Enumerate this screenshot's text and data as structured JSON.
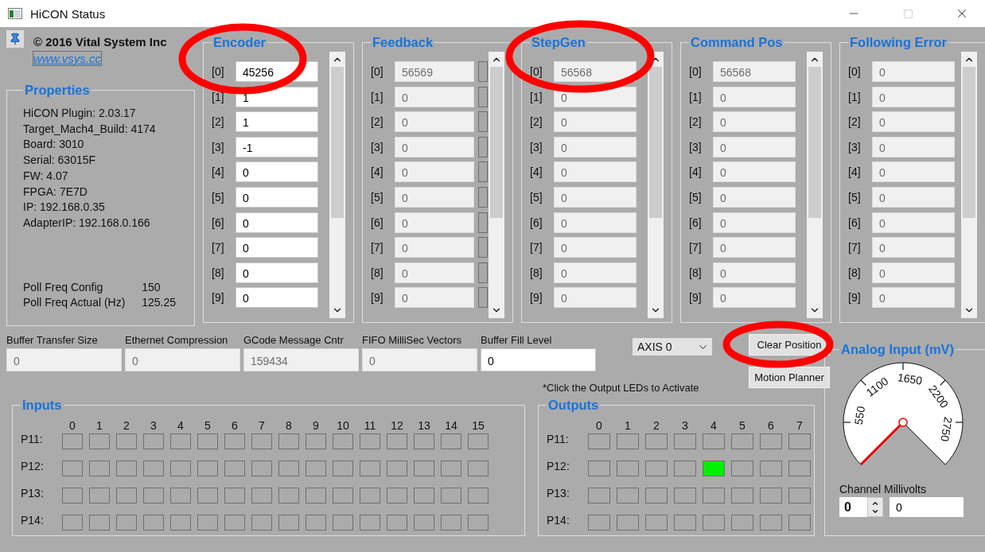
{
  "window": {
    "title": "HiCON Status"
  },
  "about": {
    "copyright": "© 2016 Vital System Inc",
    "link": "www.vsys.cc"
  },
  "properties": {
    "title": "Properties",
    "lines": [
      "HiCON Plugin: 2.03.17",
      "Target_Mach4_Build: 4174",
      "Board: 3010",
      "Serial: 63015F",
      "FW: 4.07",
      "FPGA: 7E7D",
      "IP: 192.168.0.35",
      "AdapterIP: 192.168.0.166"
    ],
    "poll": [
      {
        "label": "Poll Freq Config",
        "value": "150"
      },
      {
        "label": "Poll Freq Actual (Hz)",
        "value": "125.25"
      }
    ]
  },
  "groups": [
    {
      "title": "Encoder",
      "editable": true,
      "indicators": false,
      "circled": true,
      "rows": [
        {
          "index": "[0]",
          "value": "45256"
        },
        {
          "index": "[1]",
          "value": "1"
        },
        {
          "index": "[2]",
          "value": "1"
        },
        {
          "index": "[3]",
          "value": "-1"
        },
        {
          "index": "[4]",
          "value": "0"
        },
        {
          "index": "[5]",
          "value": "0"
        },
        {
          "index": "[6]",
          "value": "0"
        },
        {
          "index": "[7]",
          "value": "0"
        },
        {
          "index": "[8]",
          "value": "0"
        },
        {
          "index": "[9]",
          "value": "0"
        }
      ]
    },
    {
      "title": "Feedback",
      "editable": false,
      "indicators": true,
      "circled": false,
      "rows": [
        {
          "index": "[0]",
          "value": "56569"
        },
        {
          "index": "[1]",
          "value": "0"
        },
        {
          "index": "[2]",
          "value": "0"
        },
        {
          "index": "[3]",
          "value": "0"
        },
        {
          "index": "[4]",
          "value": "0"
        },
        {
          "index": "[5]",
          "value": "0"
        },
        {
          "index": "[6]",
          "value": "0"
        },
        {
          "index": "[7]",
          "value": "0"
        },
        {
          "index": "[8]",
          "value": "0"
        },
        {
          "index": "[9]",
          "value": "0"
        }
      ]
    },
    {
      "title": "StepGen",
      "editable": false,
      "indicators": false,
      "circled": true,
      "rows": [
        {
          "index": "[0]",
          "value": "56568"
        },
        {
          "index": "[1]",
          "value": "0"
        },
        {
          "index": "[2]",
          "value": "0"
        },
        {
          "index": "[3]",
          "value": "0"
        },
        {
          "index": "[4]",
          "value": "0"
        },
        {
          "index": "[5]",
          "value": "0"
        },
        {
          "index": "[6]",
          "value": "0"
        },
        {
          "index": "[7]",
          "value": "0"
        },
        {
          "index": "[8]",
          "value": "0"
        },
        {
          "index": "[9]",
          "value": "0"
        }
      ]
    },
    {
      "title": "Command Pos",
      "editable": false,
      "indicators": false,
      "circled": false,
      "rows": [
        {
          "index": "[0]",
          "value": "56568"
        },
        {
          "index": "[1]",
          "value": "0"
        },
        {
          "index": "[2]",
          "value": "0"
        },
        {
          "index": "[3]",
          "value": "0"
        },
        {
          "index": "[4]",
          "value": "0"
        },
        {
          "index": "[5]",
          "value": "0"
        },
        {
          "index": "[6]",
          "value": "0"
        },
        {
          "index": "[7]",
          "value": "0"
        },
        {
          "index": "[8]",
          "value": "0"
        },
        {
          "index": "[9]",
          "value": "0"
        }
      ]
    },
    {
      "title": "Following Error",
      "editable": false,
      "indicators": false,
      "circled": false,
      "rows": [
        {
          "index": "[0]",
          "value": "0"
        },
        {
          "index": "[1]",
          "value": "0"
        },
        {
          "index": "[2]",
          "value": "0"
        },
        {
          "index": "[3]",
          "value": "0"
        },
        {
          "index": "[4]",
          "value": "0"
        },
        {
          "index": "[5]",
          "value": "0"
        },
        {
          "index": "[6]",
          "value": "0"
        },
        {
          "index": "[7]",
          "value": "0"
        },
        {
          "index": "[8]",
          "value": "0"
        },
        {
          "index": "[9]",
          "value": "0"
        }
      ]
    }
  ],
  "stats": [
    {
      "label": "Buffer Transfer Size",
      "value": "0",
      "editable": false
    },
    {
      "label": "Ethernet Compression",
      "value": "0",
      "editable": false
    },
    {
      "label": "GCode Message Cntr",
      "value": "159434",
      "editable": false
    },
    {
      "label": "FIFO MilliSec Vectors",
      "value": "0",
      "editable": false
    },
    {
      "label": "Buffer Fill Level",
      "value": "0",
      "editable": true
    }
  ],
  "axis_select": {
    "value": "AXIS 0"
  },
  "buttons": [
    {
      "label": "Clear Position",
      "circled": true
    },
    {
      "label": "Motion Planner",
      "circled": false
    }
  ],
  "note": "*Click the Output LEDs to Activate",
  "inputs": {
    "title": "Inputs",
    "columns": [
      "0",
      "1",
      "2",
      "3",
      "4",
      "5",
      "6",
      "7",
      "8",
      "9",
      "10",
      "11",
      "12",
      "13",
      "14",
      "15"
    ],
    "rows": [
      {
        "label": "P11:",
        "leds": [
          false,
          false,
          false,
          false,
          false,
          false,
          false,
          false,
          false,
          false,
          false,
          false,
          false,
          false,
          false,
          false
        ]
      },
      {
        "label": "P12:",
        "leds": [
          false,
          false,
          false,
          false,
          false,
          false,
          false,
          false,
          false,
          false,
          false,
          false,
          false,
          false,
          false,
          false
        ]
      },
      {
        "label": "P13:",
        "leds": [
          false,
          false,
          false,
          false,
          false,
          false,
          false,
          false,
          false,
          false,
          false,
          false,
          false,
          false,
          false,
          false
        ]
      },
      {
        "label": "P14:",
        "leds": [
          false,
          false,
          false,
          false,
          false,
          false,
          false,
          false,
          false,
          false,
          false,
          false,
          false,
          false,
          false,
          false
        ]
      }
    ]
  },
  "outputs": {
    "title": "Outputs",
    "columns": [
      "0",
      "1",
      "2",
      "3",
      "4",
      "5",
      "6",
      "7"
    ],
    "rows": [
      {
        "label": "P11:",
        "leds": [
          false,
          false,
          false,
          false,
          false,
          false,
          false,
          false
        ]
      },
      {
        "label": "P12:",
        "leds": [
          false,
          false,
          false,
          false,
          true,
          false,
          false,
          false
        ]
      },
      {
        "label": "P13:",
        "leds": [
          false,
          false,
          false,
          false,
          false,
          false,
          false,
          false
        ]
      },
      {
        "label": "P14:",
        "leds": [
          false,
          false,
          false,
          false,
          false,
          false,
          false,
          false
        ]
      }
    ]
  },
  "analog": {
    "title": "Analog Input (mV)",
    "gauge_labels": [
      "550",
      "1100",
      "1650",
      "2200",
      "2750"
    ],
    "channel_label": "Channel Millivolts",
    "channel": "0",
    "millivolts": "0"
  }
}
